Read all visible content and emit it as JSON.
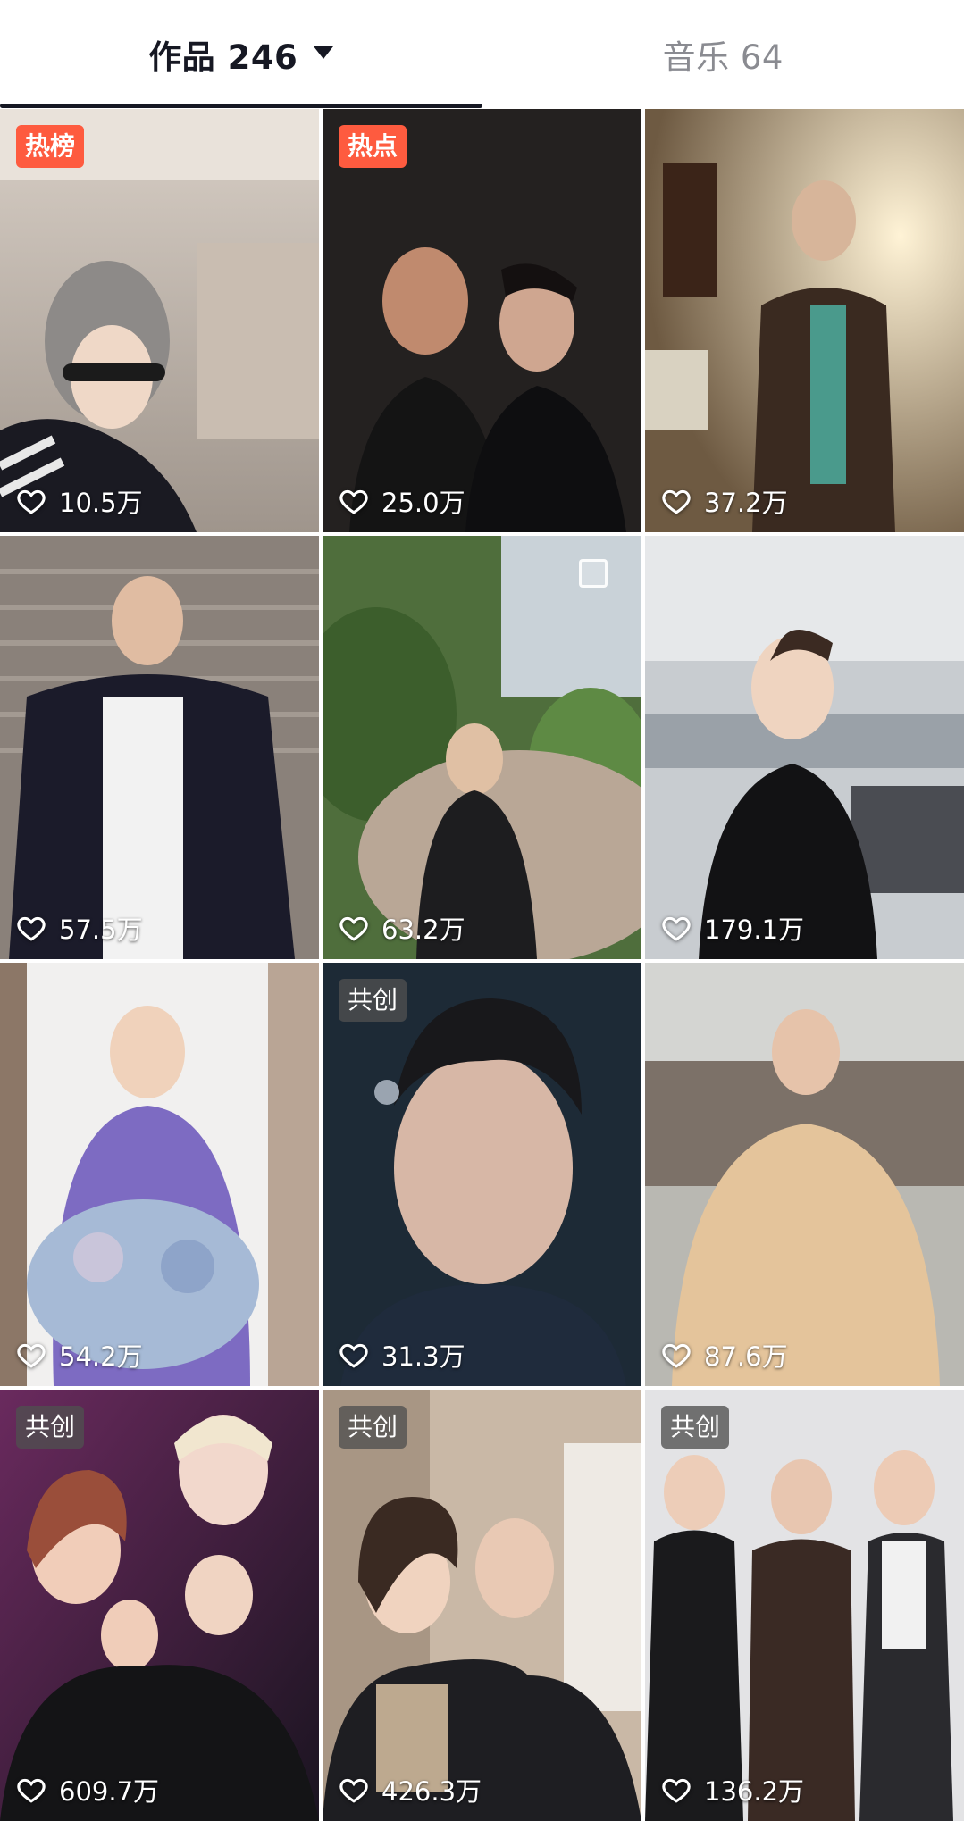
{
  "tabs": {
    "works_label": "作品 246",
    "music_label": "音乐 64"
  },
  "videos": [
    {
      "likes": "10.5万",
      "badge": "热榜"
    },
    {
      "likes": "25.0万",
      "badge": "热点"
    },
    {
      "likes": "37.2万",
      "badge": ""
    },
    {
      "likes": "57.5万",
      "badge": ""
    },
    {
      "likes": "63.2万",
      "badge": ""
    },
    {
      "likes": "179.1万",
      "badge": ""
    },
    {
      "likes": "54.2万",
      "badge": ""
    },
    {
      "likes": "31.3万",
      "badge": "共创"
    },
    {
      "likes": "87.6万",
      "badge": ""
    },
    {
      "likes": "609.7万",
      "badge": "共创"
    },
    {
      "likes": "426.3万",
      "badge": "共创"
    },
    {
      "likes": "136.2万",
      "badge": "共创"
    }
  ],
  "colors": {
    "hot_badge": "#fe5b3f",
    "collab_badge": "#505050",
    "active_tab": "#161823",
    "inactive_tab": "#8a8b91"
  },
  "icons": {
    "like": "heart-outline-icon",
    "sort": "caret-down-icon"
  }
}
